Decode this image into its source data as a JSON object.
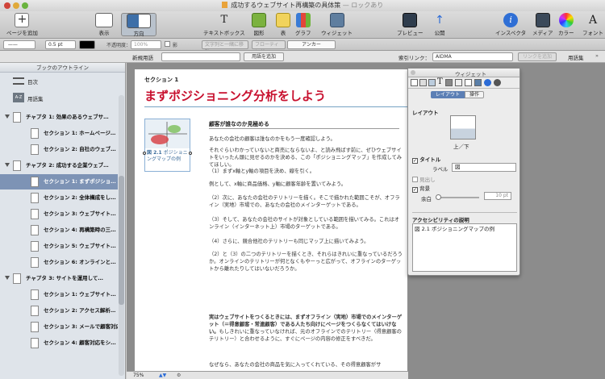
{
  "window": {
    "title": "成功するウェブサイト再構築の具体策",
    "status": "— ロックあり"
  },
  "toolbar": {
    "add_page": "ページを追加",
    "view": "表示",
    "direction": "方向",
    "textbox": "テキストボックス",
    "shapes": "図形",
    "table": "表",
    "graph": "グラフ",
    "widget": "ウィジェット",
    "preview": "プレビュー",
    "publish": "公開",
    "inspector": "インスペクタ",
    "media": "メディア",
    "colors": "カラー",
    "fonts": "フォント"
  },
  "format": {
    "stroke_width": "0.5 pt",
    "opacity_label": "不透明度：",
    "opacity_value": "100%",
    "shadow": "影",
    "wrap": "文字列と一緒に移動",
    "floating": "フローティング",
    "anchor": "アンカー"
  },
  "linkbar": {
    "new_term": "新規用語",
    "add_term": "用語を追加",
    "index_link": "索引リンク：",
    "index_value": "AIDMA",
    "add_link": "リンクを追加",
    "glossary": "用語集"
  },
  "sidebar": {
    "header": "ブックのアウトライン",
    "toc": "目次",
    "glossary": "用語集",
    "glossary_icon": "A-Z",
    "items": [
      {
        "label": "チャプタ 1: 効果のあるウェブサ…",
        "level": 0
      },
      {
        "label": "セクション 1: ホームページ…",
        "level": 1
      },
      {
        "label": "セクション 2: 自社のウェブ…",
        "level": 1
      },
      {
        "label": "チャプタ 2: 成功する企業ウェブ…",
        "level": 0
      },
      {
        "label": "セクション 1: まずポジショ…",
        "level": 1,
        "selected": true
      },
      {
        "label": "セクション 2: 全体構成をし…",
        "level": 1
      },
      {
        "label": "セクション 3: ウェブサイト…",
        "level": 1
      },
      {
        "label": "セクション 4: 再構築時の三…",
        "level": 1
      },
      {
        "label": "セクション 5: ウェブサイト…",
        "level": 1
      },
      {
        "label": "セクション 6: オンラインと…",
        "level": 1
      },
      {
        "label": "チャプタ 3: サイトを運用して…",
        "level": 0
      },
      {
        "label": "セクション 1: ウェブサイト…",
        "level": 1
      },
      {
        "label": "セクション 2: アクセス解析…",
        "level": 1
      },
      {
        "label": "セクション 3: メールで顧客対応",
        "level": 1
      },
      {
        "label": "セクション 4: 顧客対応をシ…",
        "level": 1
      }
    ]
  },
  "document": {
    "section_label": "セクション 1",
    "heading": "まずポジショニング分析をしよう",
    "figure_num": "図 2.1",
    "figure_caption": "ポジショニングマップの例",
    "subhead": "顧客が誰なのか見極める",
    "paragraphs": [
      "あなたの会社の顧客は誰なのかをもう一度確認しよう。",
      "それぐらいわかっていないと商売にならないよ、と読み飛ばす前に、ぜひウェブサイトをいったん頭に見せるのかを決める、この「ポジショニングマップ」を作成してみてほしい。",
      "（1）まずx軸とy軸の項目を決め、線を引く。",
      "例として、x軸に商品価格、y軸に顧客年齢を置いてみよう。",
      "（2）次に、あなたの会社のテリトリーを描く。そこで描かれた範囲こそが、オフライン（実地）市場での、あなたの会社のメインターゲットである。",
      "（3）そして、あなたの会社のサイトが対象としている範囲を描いてみる。これはオンライン（インターネット上）市場のターゲットである。",
      "（4）さらに、競合他社のテリトリーも同じマップ上に描いてみよう。",
      "（2）と（3）の二つのテリトリーを描くとき、それらはきれいに重なっているだろうか。オンラインのテリトリーが何となくもやーっと広がって、オフラインのターゲットから離れたりしてはいないだろうか。"
    ],
    "bold_para": "実はウェブサイトをつくるときには、まずオフライン（実地）市場でのメインターゲット（＝得意顧客・常連顧客）である人たち向けにページをつくらなくてはいけない。",
    "bold_tail": "もしきれいに重なっていなければ、元のオフラインでのテリトリー（得意顧客のテリトリー）と合わせるように、すぐにページの内容の修正をすべきだ。",
    "last_para": "なぜなら、あなたの会社の商品を気に入ってくれている、その得意顧客がサ"
  },
  "status": {
    "zoom": "75%"
  },
  "widget": {
    "title": "ウィジェット",
    "tab_layout": "レイアウト",
    "tab_action": "操作",
    "layout_label": "レイアウト",
    "layout_value": "上／下",
    "title_check": "タイトル",
    "label_label": "ラベル",
    "label_value": "図",
    "caption_check": "見出し",
    "background_check": "背景",
    "margin_label": "余白",
    "margin_value": "10 pt",
    "a11y_label": "アクセシビリティの説明",
    "a11y_value": "図 2.1 ポジショニングマップの例"
  },
  "colors": {
    "accent": "#c8102e",
    "selection": "#7d93b5"
  }
}
